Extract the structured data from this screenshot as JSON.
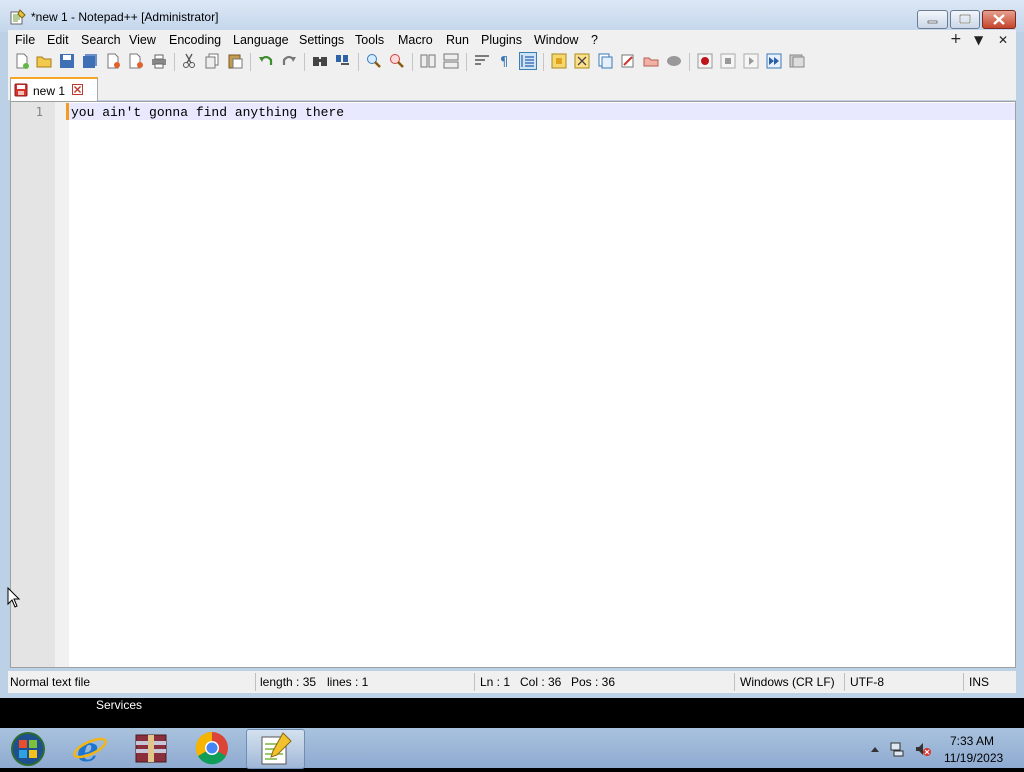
{
  "window": {
    "title": "*new 1 - Notepad++ [Administrator]"
  },
  "menu": {
    "items": [
      "File",
      "Edit",
      "Search",
      "View",
      "Encoding",
      "Language",
      "Settings",
      "Tools",
      "Macro",
      "Run",
      "Plugins",
      "Window",
      "?"
    ],
    "right": [
      "+",
      "▼",
      "✕"
    ]
  },
  "toolbar": {
    "icons": [
      "new-file-icon",
      "open-file-icon",
      "save-icon",
      "save-all-icon",
      "close-icon",
      "close-all-icon",
      "print-icon",
      "cut-icon",
      "copy-icon",
      "paste-icon",
      "undo-icon",
      "redo-icon",
      "find-icon",
      "replace-icon",
      "zoom-in-icon",
      "zoom-out-icon",
      "sync-vertical-icon",
      "sync-horizontal-icon",
      "word-wrap-icon",
      "show-all-chars-icon",
      "indent-guide-icon",
      "user-defined-language-icon",
      "document-map-icon",
      "function-list-icon",
      "folder-as-workspace-icon",
      "monitoring-icon",
      "record-macro-icon",
      "stop-record-icon",
      "play-macro-icon",
      "run-macro-multiple-icon",
      "save-macro-icon"
    ]
  },
  "tab": {
    "label": "new 1"
  },
  "editor": {
    "line_number": "1",
    "text": "you ain't gonna find anything there"
  },
  "status": {
    "file_type": "Normal text file",
    "length": "length : 35",
    "lines": "lines : 1",
    "ln": "Ln : 1",
    "col": "Col : 36",
    "pos": "Pos : 36",
    "eol": "Windows (CR LF)",
    "encoding": "UTF-8",
    "mode": "INS"
  },
  "taskbar": {
    "services_label": "Services",
    "apps": [
      "start-orb-icon",
      "internet-explorer-icon",
      "archive-app-icon",
      "chrome-icon",
      "notepad-plus-plus-icon"
    ],
    "time": "7:33 AM",
    "date": "11/19/2023"
  }
}
